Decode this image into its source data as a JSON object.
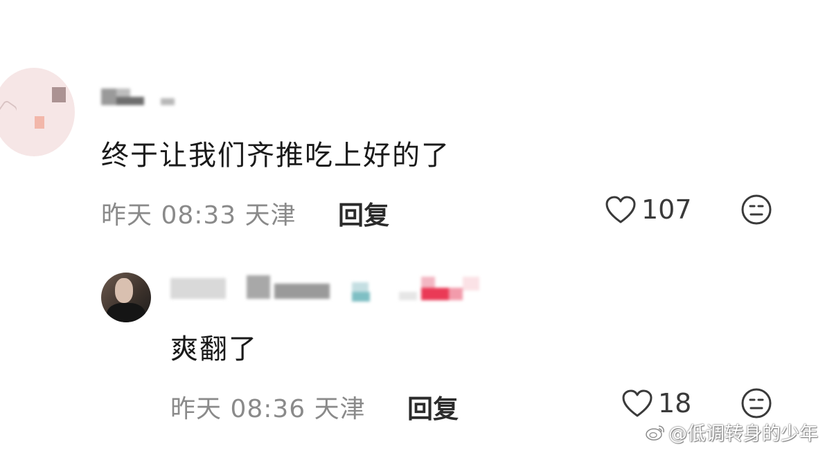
{
  "comments": [
    {
      "text": "终于让我们齐推吃上好的了",
      "time": "昨天 08:33",
      "location": "天津",
      "reply_label": "回复",
      "likes": "107"
    },
    {
      "text": "爽翻了",
      "time": "昨天 08:36",
      "location": "天津",
      "reply_label": "回复",
      "likes": "18"
    }
  ],
  "watermark": "@低调转身的少年",
  "icons": {
    "like": "heart-outline-icon",
    "reaction": "meh-face-icon",
    "watermark": "weibo-icon"
  },
  "colors": {
    "text": "#1a1a1a",
    "meta": "#8a8a8a",
    "reply": "#2b2b2b"
  }
}
